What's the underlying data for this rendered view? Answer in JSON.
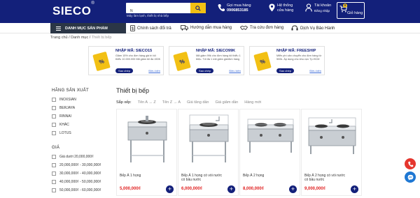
{
  "header": {
    "logo": "SIECO",
    "logo_mark": "®",
    "search_value": "N",
    "search_hint": "Máy làm lạnh, thiết bị nhà bếp",
    "contact_title": "Gọi mua hàng",
    "contact_phone": "0906853185",
    "store_title": "Hệ thống",
    "store_subtitle": "cửa hàng",
    "account_title": "Tài khoản",
    "account_subtitle": "Đăng nhập",
    "cart_count": "0",
    "cart_label": "Giỏ hàng"
  },
  "nav": {
    "category_button": "DANH MỤC SẢN PHẨM",
    "items": [
      "Chính sách đổi trả",
      "Hướng dẫn mua hàng",
      "Tra cứu đơn hàng",
      "Dịch Vụ Bảo Hành"
    ]
  },
  "breadcrumb": {
    "home": "Trang chủ",
    "sep": "/",
    "category": "Danh mục",
    "current": "Thiết bị bếp"
  },
  "coupons": [
    {
      "title": "NHẬP MÃ: SIECO15",
      "desc": "Giảm 15% cho đơn hàng giá trị tối thiểu 10.000.000 Mã giảm tối đa 150K",
      "copy": "Sao chép",
      "cond": "Điều kiện"
    },
    {
      "title": "NHẬP MÃ: SIECO99K",
      "desc": "Mã giảm 99k cho đơn hàng tối thiểu 1 triệu. Tối đa 1 mã giảm giá/đơn hàng",
      "copy": "Sao chép",
      "cond": "Điều kiện"
    },
    {
      "title": "NHẬP MÃ: FREESHIP",
      "desc": "Miễn phí vận chuyển cho đơn hàng từ 500k. Áp dụng cho khu vực Tp.HCM",
      "copy": "Sao chép",
      "cond": "Điều kiện"
    }
  ],
  "sidebar": {
    "brand_heading": "HÃNG SẢN XUẤT",
    "brands": [
      "INOXSIAN",
      "BERJAYA",
      "RINNAI",
      "KHÁC",
      "LOTUS"
    ],
    "price_heading": "GIÁ",
    "prices": [
      "Giá dưới 20,000,000₫",
      "20,000,000₫ - 30,000,000₫",
      "30,000,000₫ - 40,000,000₫",
      "40,000,000₫ - 50,000,000₫",
      "50,000,000₫ - 60,000,000₫"
    ]
  },
  "main": {
    "title": "Thiết bị bếp",
    "sort_label": "Sắp xếp:",
    "sort_options": [
      "Tên A → Z",
      "Tên Z → A",
      "Giá tăng dần",
      "Giá giảm dần",
      "Hàng mới"
    ]
  },
  "products": [
    {
      "name": "Bếp Á 1 họng",
      "price": "5,000,000₫"
    },
    {
      "name": "Bếp Á 1 họng có vòi nước có bầu nước",
      "price": "6,000,000₫"
    },
    {
      "name": "Bếp Á 2 họng",
      "price": "8,000,000₫"
    },
    {
      "name": "Bếp Á 2 họng có vòi nước có bầu nước",
      "price": "9,000,000₫"
    }
  ],
  "colors": {
    "brand_navy": "#13207a",
    "accent_yellow": "#f2c014",
    "price_red": "#e02020",
    "category_dark": "#2b3646",
    "fab_red": "#e5362e",
    "fab_blue": "#1e77d3"
  },
  "icons": {
    "search": "search-icon",
    "phone": "phone-icon",
    "store": "location-pin-icon",
    "account": "user-icon",
    "cart": "cart-icon",
    "menu": "hamburger-icon",
    "nav": [
      "dollar-icon",
      "truck-icon",
      "handshake-icon",
      "headset-icon"
    ],
    "add": "plus-icon",
    "fab": [
      "phone-icon",
      "messenger-icon"
    ]
  }
}
